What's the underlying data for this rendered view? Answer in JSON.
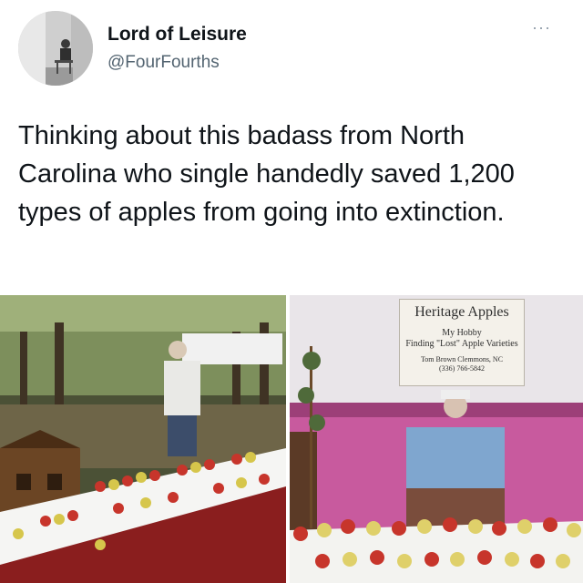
{
  "author": {
    "name": "Lord of Leisure",
    "handle": "@FourFourths"
  },
  "menu": {
    "icon": "more-icon",
    "glyph": "···"
  },
  "tweet": {
    "text": "Thinking about this badass from North Carolina who single handedly saved 1,200 types of apples from going into extinction."
  },
  "photos": {
    "left": {
      "subject": "apples-outdoor-photo"
    },
    "right": {
      "subject": "heritage-apples-booth-photo",
      "sign": {
        "title": "Heritage Apples",
        "line1": "My Hobby",
        "line2": "Finding \"Lost\" Apple Varieties",
        "line3": "Tom Brown  Clemmons, NC",
        "line4": "(336) 766-5842"
      }
    }
  }
}
